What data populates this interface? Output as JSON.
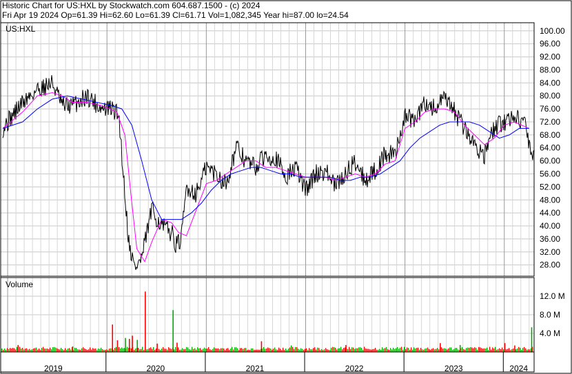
{
  "header": {
    "line1": "Historic Chart for US:HXL by Stockwatch.com 604.687.1500 - (c) 2024",
    "line2": "Fri Apr 19 2024   Op=61.39   Hi=62.60   Lo=61.39   Cl=61.71   Vol=1,082,345   Year hi=87.00   lo=24.54"
  },
  "chart_data": [
    {
      "type": "line",
      "panel": "price",
      "title": "US:HXL",
      "ylim": [
        24.54,
        102.5
      ],
      "y_ticks": [
        "100.00",
        "96.00",
        "92.00",
        "88.00",
        "84.00",
        "80.00",
        "76.00",
        "72.00",
        "68.00",
        "64.00",
        "60.00",
        "56.00",
        "52.00",
        "48.00",
        "44.00",
        "40.00",
        "36.00",
        "32.00",
        "28.00"
      ],
      "y_tick_values": [
        100,
        96,
        92,
        88,
        84,
        80,
        76,
        72,
        68,
        64,
        60,
        56,
        52,
        48,
        44,
        40,
        36,
        32,
        28
      ],
      "x_labels": [
        "2019",
        "2020",
        "2021",
        "2022",
        "2023",
        "2024"
      ],
      "grid": true,
      "colors": {
        "price": "#000000",
        "ma_short": "#ff00ff",
        "ma_long": "#0000ff"
      },
      "series": [
        {
          "key": "price",
          "x": [
            2018.95,
            2019.15,
            2019.3,
            2019.45,
            2019.55,
            2019.65,
            2019.8,
            2019.95,
            2020.05,
            2020.12,
            2020.18,
            2020.22,
            2020.28,
            2020.35,
            2020.45,
            2020.55,
            2020.65,
            2020.7,
            2020.75,
            2020.8,
            2020.9,
            2021.0,
            2021.1,
            2021.2,
            2021.3,
            2021.4,
            2021.5,
            2021.6,
            2021.7,
            2021.8,
            2021.9,
            2022.0,
            2022.1,
            2022.2,
            2022.3,
            2022.4,
            2022.5,
            2022.6,
            2022.7,
            2022.8,
            2022.9,
            2023.0,
            2023.1,
            2023.2,
            2023.3,
            2023.4,
            2023.5,
            2023.6,
            2023.7,
            2023.8,
            2023.9,
            2024.0,
            2024.1,
            2024.2,
            2024.28,
            2024.3
          ],
          "y": [
            70,
            78,
            82,
            84,
            77,
            77,
            80,
            76,
            76,
            74,
            50,
            35,
            27,
            30,
            45,
            40,
            38,
            34,
            36,
            52,
            50,
            58,
            56,
            53,
            64,
            60,
            58,
            62,
            61,
            55,
            58,
            51,
            56,
            57,
            52,
            56,
            60,
            54,
            57,
            62,
            62,
            74,
            72,
            78,
            76,
            79,
            75,
            70,
            65,
            62,
            70,
            72,
            74,
            72,
            61.71,
            61.71
          ]
        },
        {
          "key": "ma_short",
          "x": [
            2018.95,
            2019.15,
            2019.3,
            2019.45,
            2019.55,
            2019.65,
            2019.8,
            2019.95,
            2020.1,
            2020.18,
            2020.24,
            2020.3,
            2020.38,
            2020.45,
            2020.55,
            2020.65,
            2020.72,
            2020.8,
            2020.9,
            2021.0,
            2021.1,
            2021.2,
            2021.3,
            2021.4,
            2021.5,
            2021.6,
            2021.7,
            2021.8,
            2021.9,
            2022.0,
            2022.1,
            2022.2,
            2022.3,
            2022.4,
            2022.5,
            2022.6,
            2022.7,
            2022.8,
            2022.9,
            2023.0,
            2023.1,
            2023.2,
            2023.3,
            2023.4,
            2023.5,
            2023.6,
            2023.7,
            2023.8,
            2023.9,
            2024.0,
            2024.1,
            2024.25
          ],
          "y": [
            70,
            75,
            80,
            81,
            80,
            78,
            78,
            77,
            75,
            68,
            50,
            33,
            29,
            35,
            42,
            41,
            38,
            37,
            45,
            53,
            54,
            56,
            58,
            60,
            60,
            58,
            58,
            57,
            56,
            55,
            55,
            55,
            54,
            55,
            56,
            55,
            56,
            59,
            60,
            70,
            72,
            75,
            76,
            76,
            75,
            71,
            68,
            65,
            67,
            71,
            72,
            70
          ]
        },
        {
          "key": "ma_long",
          "x": [
            2018.95,
            2019.15,
            2019.3,
            2019.45,
            2019.6,
            2019.75,
            2019.9,
            2020.05,
            2020.15,
            2020.25,
            2020.35,
            2020.45,
            2020.55,
            2020.65,
            2020.75,
            2020.85,
            2020.95,
            2021.05,
            2021.15,
            2021.25,
            2021.35,
            2021.45,
            2021.55,
            2021.65,
            2021.75,
            2021.85,
            2021.95,
            2022.05,
            2022.15,
            2022.25,
            2022.35,
            2022.45,
            2022.55,
            2022.65,
            2022.75,
            2022.85,
            2022.95,
            2023.05,
            2023.15,
            2023.25,
            2023.35,
            2023.45,
            2023.55,
            2023.65,
            2023.75,
            2023.85,
            2023.95,
            2024.05,
            2024.15,
            2024.25
          ],
          "y": [
            70,
            72,
            76,
            79,
            80,
            79,
            78,
            77,
            76,
            71,
            60,
            48,
            42,
            42,
            42,
            44,
            47,
            51,
            54,
            56,
            57,
            58,
            58,
            57,
            56,
            56,
            55,
            55,
            55,
            55,
            54,
            54,
            55,
            55,
            56,
            58,
            60,
            64,
            67,
            69,
            71,
            72,
            72,
            72,
            71,
            69,
            67,
            68,
            70,
            70
          ]
        }
      ]
    },
    {
      "type": "bar",
      "panel": "volume",
      "title": "Volume",
      "y_ticks": [
        "12.0 M",
        "8.0 M",
        "4.0 M"
      ],
      "y_tick_values": [
        12,
        8,
        4
      ],
      "ylim": [
        0,
        16
      ],
      "units": "M",
      "colors": {
        "up": "#00aa00",
        "down": "#ff0000"
      },
      "baseline_volume_m": 0.8,
      "spikes": [
        {
          "x": 2019.1,
          "value": 1.5
        },
        {
          "x": 2019.65,
          "value": 1.2
        },
        {
          "x": 2020.05,
          "value": 5.9
        },
        {
          "x": 2020.1,
          "value": 2.5
        },
        {
          "x": 2020.18,
          "value": 3.0
        },
        {
          "x": 2020.22,
          "value": 2.8
        },
        {
          "x": 2020.25,
          "value": 3.5
        },
        {
          "x": 2020.3,
          "value": 2.6
        },
        {
          "x": 2020.38,
          "value": 13.0
        },
        {
          "x": 2020.5,
          "value": 1.8
        },
        {
          "x": 2020.66,
          "value": 9.0
        },
        {
          "x": 2020.7,
          "value": 2.0
        },
        {
          "x": 2021.55,
          "value": 2.3
        },
        {
          "x": 2021.85,
          "value": 1.4
        },
        {
          "x": 2022.4,
          "value": 1.5
        },
        {
          "x": 2023.35,
          "value": 1.9
        },
        {
          "x": 2023.55,
          "value": 1.5
        },
        {
          "x": 2024.0,
          "value": 1.9
        },
        {
          "x": 2024.1,
          "value": 1.4
        },
        {
          "x": 2024.27,
          "value": 5.3
        }
      ]
    }
  ]
}
